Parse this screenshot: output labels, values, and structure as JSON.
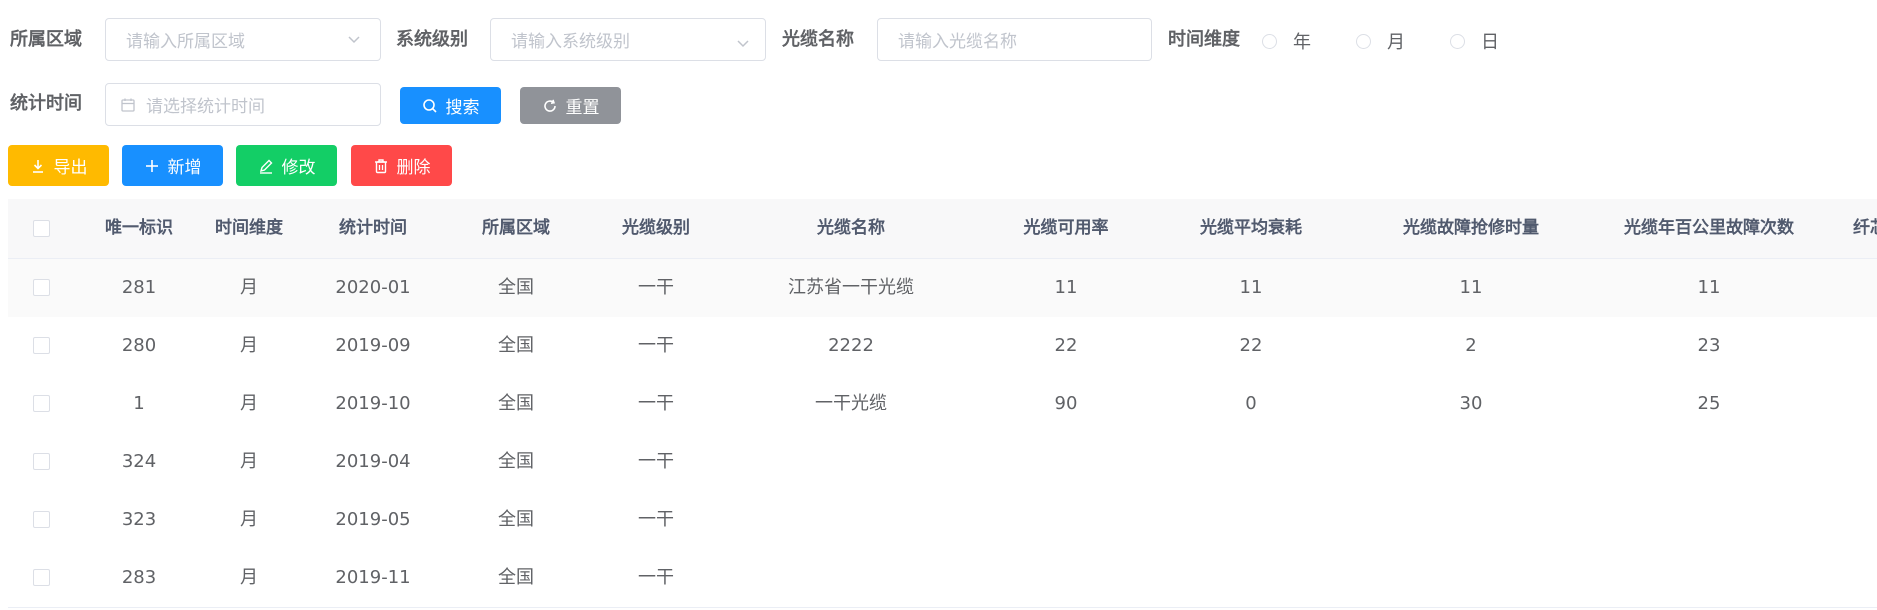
{
  "filters": {
    "region_label": "所属区域",
    "region_placeholder": "请输入所属区域",
    "system_label": "系统级别",
    "system_placeholder": "请输入系统级别",
    "cable_label": "光缆名称",
    "cable_placeholder": "请输入光缆名称",
    "time_dim_label": "时间维度",
    "time_options": [
      "年",
      "月",
      "日"
    ],
    "stat_time_label": "统计时间",
    "stat_time_placeholder": "请选择统计时间",
    "search_button": "搜索",
    "reset_button": "重置"
  },
  "toolbar": {
    "export_label": "导出",
    "add_label": "新增",
    "edit_label": "修改",
    "delete_label": "删除"
  },
  "colors": {
    "primary": "#1890ff",
    "gray": "#909399",
    "warning": "#ffba00",
    "success": "#13ce66",
    "danger": "#ff4949"
  },
  "table": {
    "columns": [
      "唯一标识",
      "时间维度",
      "统计时间",
      "所属区域",
      "光缆级别",
      "光缆名称",
      "光缆可用率",
      "光缆平均衰耗",
      "光缆故障抢修时量",
      "光缆年百公里故障次数",
      "纤芯"
    ],
    "rows": [
      [
        "281",
        "月",
        "2020-01",
        "全国",
        "一干",
        "江苏省一干光缆",
        "11",
        "11",
        "11",
        "11"
      ],
      [
        "280",
        "月",
        "2019-09",
        "全国",
        "一干",
        "2222",
        "22",
        "22",
        "2",
        "23"
      ],
      [
        "1",
        "月",
        "2019-10",
        "全国",
        "一干",
        "一干光缆",
        "90",
        "0",
        "30",
        "25"
      ],
      [
        "324",
        "月",
        "2019-04",
        "全国",
        "一干",
        "",
        "",
        "",
        "",
        ""
      ],
      [
        "323",
        "月",
        "2019-05",
        "全国",
        "一干",
        "",
        "",
        "",
        "",
        ""
      ],
      [
        "283",
        "月",
        "2019-11",
        "全国",
        "一干",
        "",
        "",
        "",
        "",
        ""
      ]
    ]
  }
}
